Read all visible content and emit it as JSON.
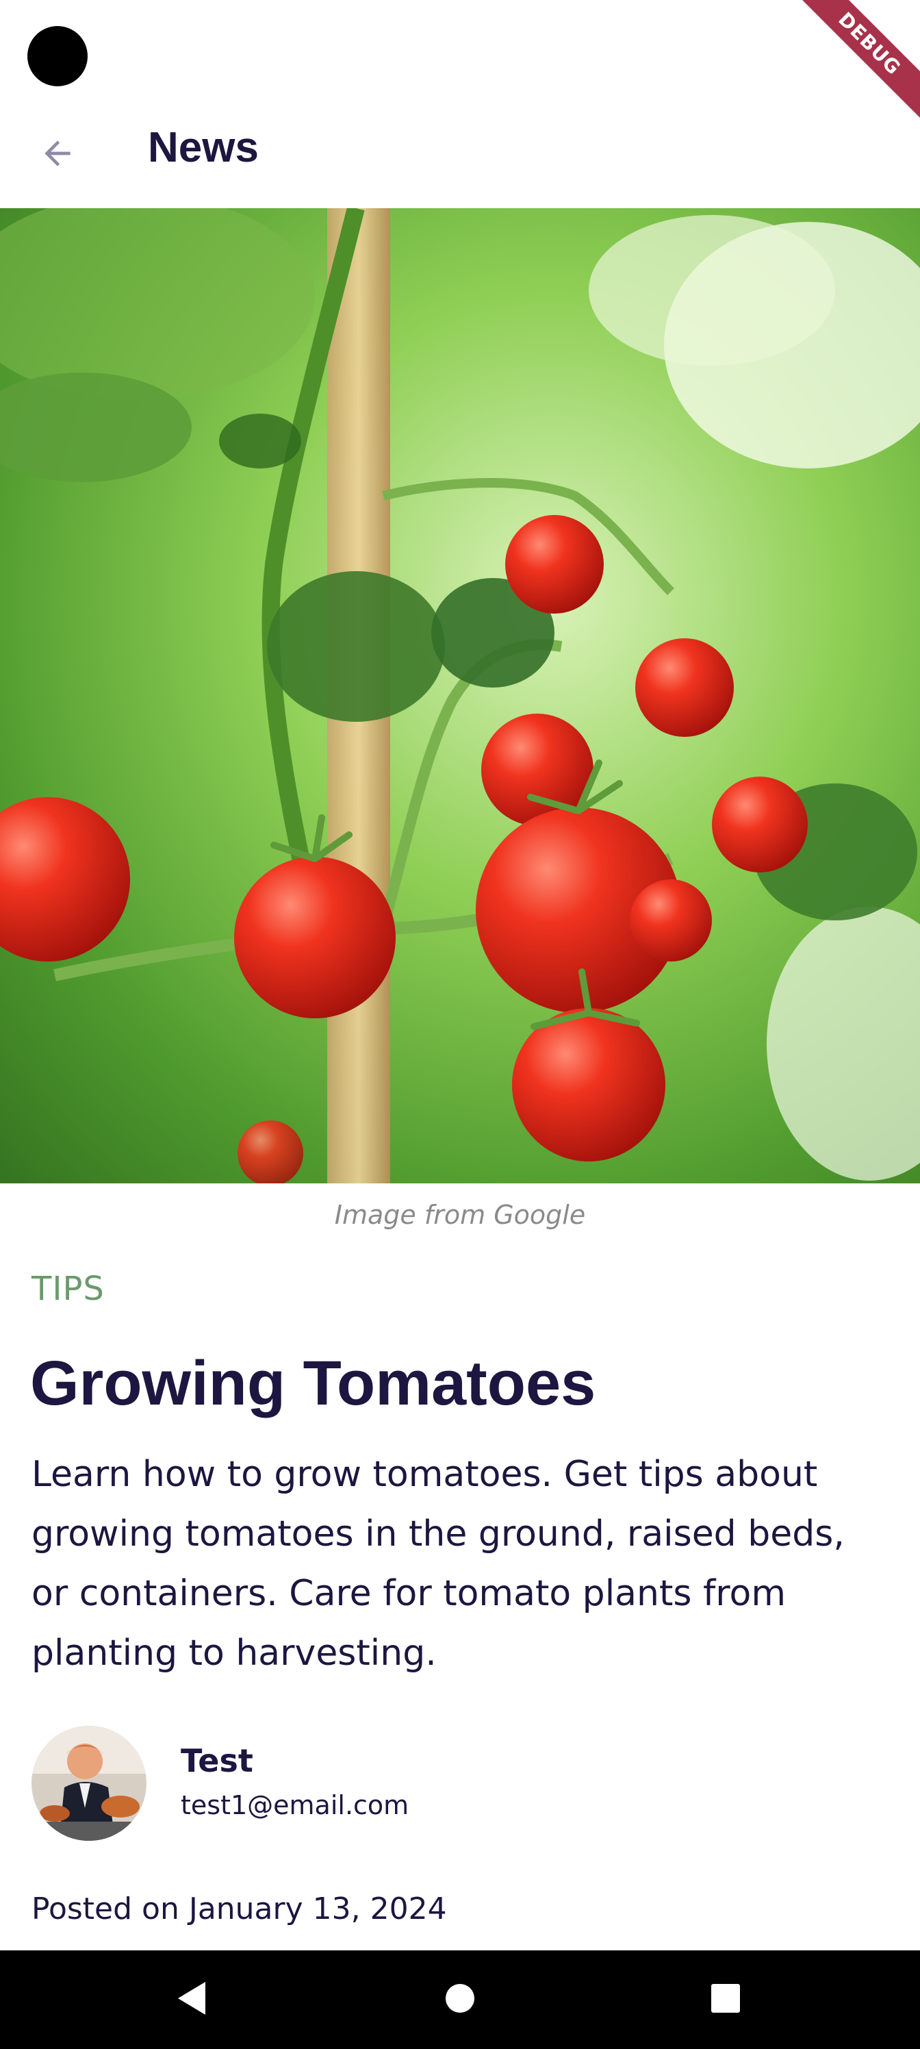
{
  "status": {
    "debug_banner": "DEBUG"
  },
  "app_bar": {
    "back_icon": "arrow-back-icon",
    "title": "News"
  },
  "article": {
    "image_caption": "Image from Google",
    "category": "TIPS",
    "title": "Growing Tomatoes",
    "body": "Learn how to grow tomatoes. Get tips about growing tomatoes in the ground, raised beds, or containers. Care for tomato plants from planting to harvesting.",
    "author": {
      "name": "Test",
      "email": "test1@email.com"
    },
    "posted": "Posted on January 13, 2024"
  },
  "navigation": {
    "back_icon": "triangle-back-icon",
    "home_icon": "circle-home-icon",
    "recents_icon": "square-recents-icon"
  },
  "colors": {
    "title": "#1c1640",
    "category": "#6a9a6b",
    "caption": "#8a8a8a",
    "debug_banner": "#a7324a"
  }
}
